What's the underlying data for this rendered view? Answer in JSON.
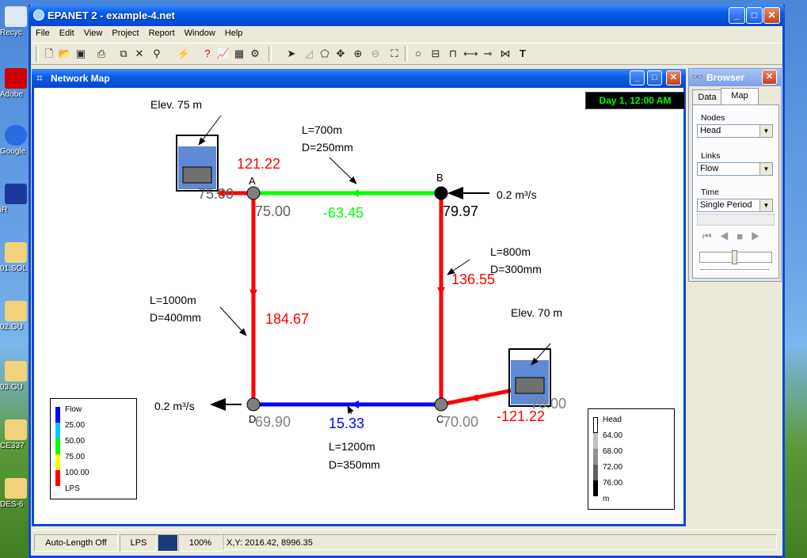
{
  "window": {
    "title": "EPANET 2 - example-4.net"
  },
  "menu": [
    "File",
    "Edit",
    "View",
    "Project",
    "Report",
    "Window",
    "Help"
  ],
  "desktop_icons": [
    "Recyc",
    "Adobe",
    "Google",
    "iR",
    "01.SOL",
    "02.GU",
    "03.GU",
    "CE337",
    "DES-6"
  ],
  "map_window": {
    "title": "Network Map",
    "time": "Day 1, 12:00 AM"
  },
  "map": {
    "reservoir1_label": "Elev. 75 m",
    "reservoir2_label": "Elev. 70 m",
    "node_a": "A",
    "node_b": "B",
    "node_c": "C",
    "node_d": "D",
    "head_res1": "75.00",
    "head_a": "75.00",
    "head_b": "79.97",
    "head_c": "70.00",
    "head_d": "69.90",
    "head_res2": "70.00",
    "flow_res1_a": "121.22",
    "flow_ab": "-63.45",
    "flow_bc": "136.55",
    "flow_ad": "184.67",
    "flow_cd": "15.33",
    "flow_res2_c": "-121.22",
    "demand_b": "0.2 m³/s",
    "demand_d": "0.2 m³/s",
    "pipe_ab_l": "L=700m",
    "pipe_ab_d": "D=250mm",
    "pipe_bc_l": "L=800m",
    "pipe_bc_d": "D=300mm",
    "pipe_ad_l": "L=1000m",
    "pipe_ad_d": "D=400mm",
    "pipe_cd_l": "L=1200m",
    "pipe_cd_d": "D=350mm"
  },
  "flow_legend": {
    "title": "Flow",
    "items": [
      "25.00",
      "50.00",
      "75.00",
      "100.00"
    ],
    "unit": "LPS",
    "colors": [
      "#0000ff",
      "#00c8ff",
      "#00ff00",
      "#ffff00",
      "#ff0000"
    ]
  },
  "head_legend": {
    "title": "Head",
    "items": [
      "64.00",
      "68.00",
      "72.00",
      "76.00"
    ],
    "unit": "m",
    "colors": [
      "#ffffff",
      "#c0c0c0",
      "#909090",
      "#606060",
      "#000000"
    ]
  },
  "browser": {
    "title": "Browser",
    "tabs": [
      "Data",
      "Map"
    ],
    "nodes_label": "Nodes",
    "nodes_value": "Head",
    "links_label": "Links",
    "links_value": "Flow",
    "time_label": "Time",
    "time_value": "Single Period"
  },
  "status": {
    "autolength": "Auto-Length Off",
    "units": "LPS",
    "zoom": "100%",
    "xy": "X,Y: 2016.42, 8996.35"
  }
}
